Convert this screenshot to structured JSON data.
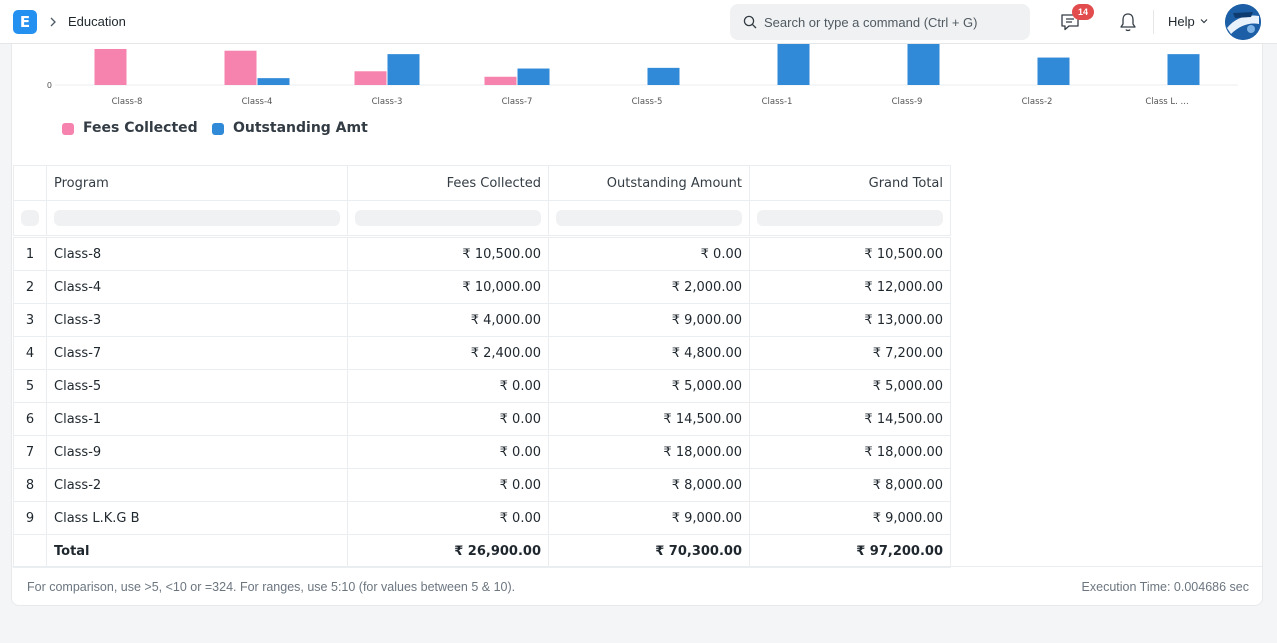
{
  "navbar": {
    "app_logo_letter": "E",
    "breadcrumb": "Education",
    "search_placeholder": "Search or type a command (Ctrl + G)",
    "notification_count": "14",
    "help_label": "Help"
  },
  "chart_data": {
    "type": "bar",
    "categories": [
      "Class-8",
      "Class-4",
      "Class-3",
      "Class-7",
      "Class-5",
      "Class-1",
      "Class-9",
      "Class-2",
      "Class L. ..."
    ],
    "series": [
      {
        "name": "Fees Collected",
        "color": "#f683ae",
        "values": [
          10500,
          10000,
          4000,
          2400,
          0,
          0,
          0,
          0,
          0
        ]
      },
      {
        "name": "Outstanding Amt",
        "color": "#318ad8",
        "values": [
          0,
          2000,
          9000,
          4800,
          5000,
          14500,
          18000,
          8000,
          9000
        ]
      }
    ],
    "y_tick_visible": "0"
  },
  "table": {
    "columns": [
      "Program",
      "Fees Collected",
      "Outstanding Amount",
      "Grand Total"
    ],
    "rows": [
      {
        "idx": "1",
        "program": "Class-8",
        "fees": "₹ 10,500.00",
        "outstanding": "₹ 0.00",
        "total": "₹ 10,500.00"
      },
      {
        "idx": "2",
        "program": "Class-4",
        "fees": "₹ 10,000.00",
        "outstanding": "₹ 2,000.00",
        "total": "₹ 12,000.00"
      },
      {
        "idx": "3",
        "program": "Class-3",
        "fees": "₹ 4,000.00",
        "outstanding": "₹ 9,000.00",
        "total": "₹ 13,000.00"
      },
      {
        "idx": "4",
        "program": "Class-7",
        "fees": "₹ 2,400.00",
        "outstanding": "₹ 4,800.00",
        "total": "₹ 7,200.00"
      },
      {
        "idx": "5",
        "program": "Class-5",
        "fees": "₹ 0.00",
        "outstanding": "₹ 5,000.00",
        "total": "₹ 5,000.00"
      },
      {
        "idx": "6",
        "program": "Class-1",
        "fees": "₹ 0.00",
        "outstanding": "₹ 14,500.00",
        "total": "₹ 14,500.00"
      },
      {
        "idx": "7",
        "program": "Class-9",
        "fees": "₹ 0.00",
        "outstanding": "₹ 18,000.00",
        "total": "₹ 18,000.00"
      },
      {
        "idx": "8",
        "program": "Class-2",
        "fees": "₹ 0.00",
        "outstanding": "₹ 8,000.00",
        "total": "₹ 8,000.00"
      },
      {
        "idx": "9",
        "program": "Class L.K.G B",
        "fees": "₹ 0.00",
        "outstanding": "₹ 9,000.00",
        "total": "₹ 9,000.00"
      }
    ],
    "total": {
      "label": "Total",
      "fees": "₹ 26,900.00",
      "outstanding": "₹ 70,300.00",
      "total": "₹ 97,200.00"
    }
  },
  "footer": {
    "hint": "For comparison, use >5, <10 or =324. For ranges, use 5:10 (for values between 5 & 10).",
    "execution_time": "Execution Time: 0.004686 sec"
  }
}
